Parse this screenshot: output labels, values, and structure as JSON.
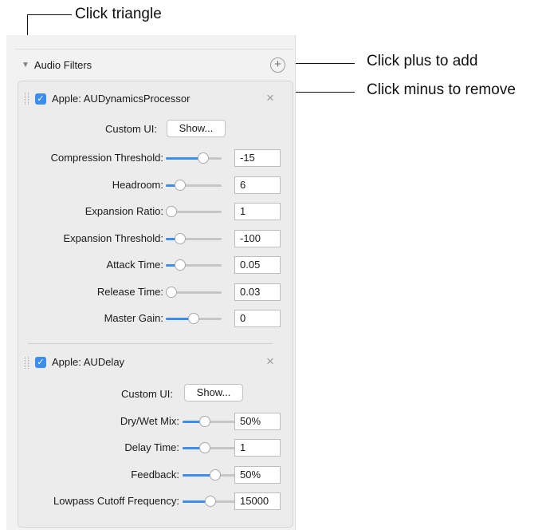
{
  "callouts": {
    "triangle": "Click triangle",
    "plus": "Click plus to add",
    "minus": "Click minus to remove"
  },
  "header": {
    "title": "Audio Filters",
    "plus_glyph": "+"
  },
  "filters": [
    {
      "name": "Apple: AUDynamicsProcessor",
      "custom_ui_label": "Custom UI:",
      "show_label": "Show...",
      "params": [
        {
          "label": "Compression Threshold:",
          "value": "-15",
          "level": 0.72
        },
        {
          "label": "Headroom:",
          "value": "6",
          "level": 0.2
        },
        {
          "label": "Expansion Ratio:",
          "value": "1",
          "level": 0.0
        },
        {
          "label": "Expansion Threshold:",
          "value": "-100",
          "level": 0.2
        },
        {
          "label": "Attack Time:",
          "value": "0.05",
          "level": 0.2
        },
        {
          "label": "Release Time:",
          "value": "0.03",
          "level": 0.0
        },
        {
          "label": "Master Gain:",
          "value": "0",
          "level": 0.5
        }
      ]
    },
    {
      "name": "Apple: AUDelay",
      "custom_ui_label": "Custom UI:",
      "show_label": "Show...",
      "params": [
        {
          "label": "Dry/Wet Mix:",
          "value": "50%",
          "level": 0.38
        },
        {
          "label": "Delay Time:",
          "value": "1",
          "level": 0.38
        },
        {
          "label": "Feedback:",
          "value": "50%",
          "level": 0.6
        },
        {
          "label": "Lowpass Cutoff Frequency:",
          "value": "15000",
          "level": 0.5
        }
      ]
    }
  ],
  "icons": {
    "checkbox": "checkmark-icon",
    "close": "close-icon",
    "expand": "disclosure-triangle-icon",
    "add": "plus-icon"
  },
  "colors": {
    "accent": "#3b8df0"
  }
}
